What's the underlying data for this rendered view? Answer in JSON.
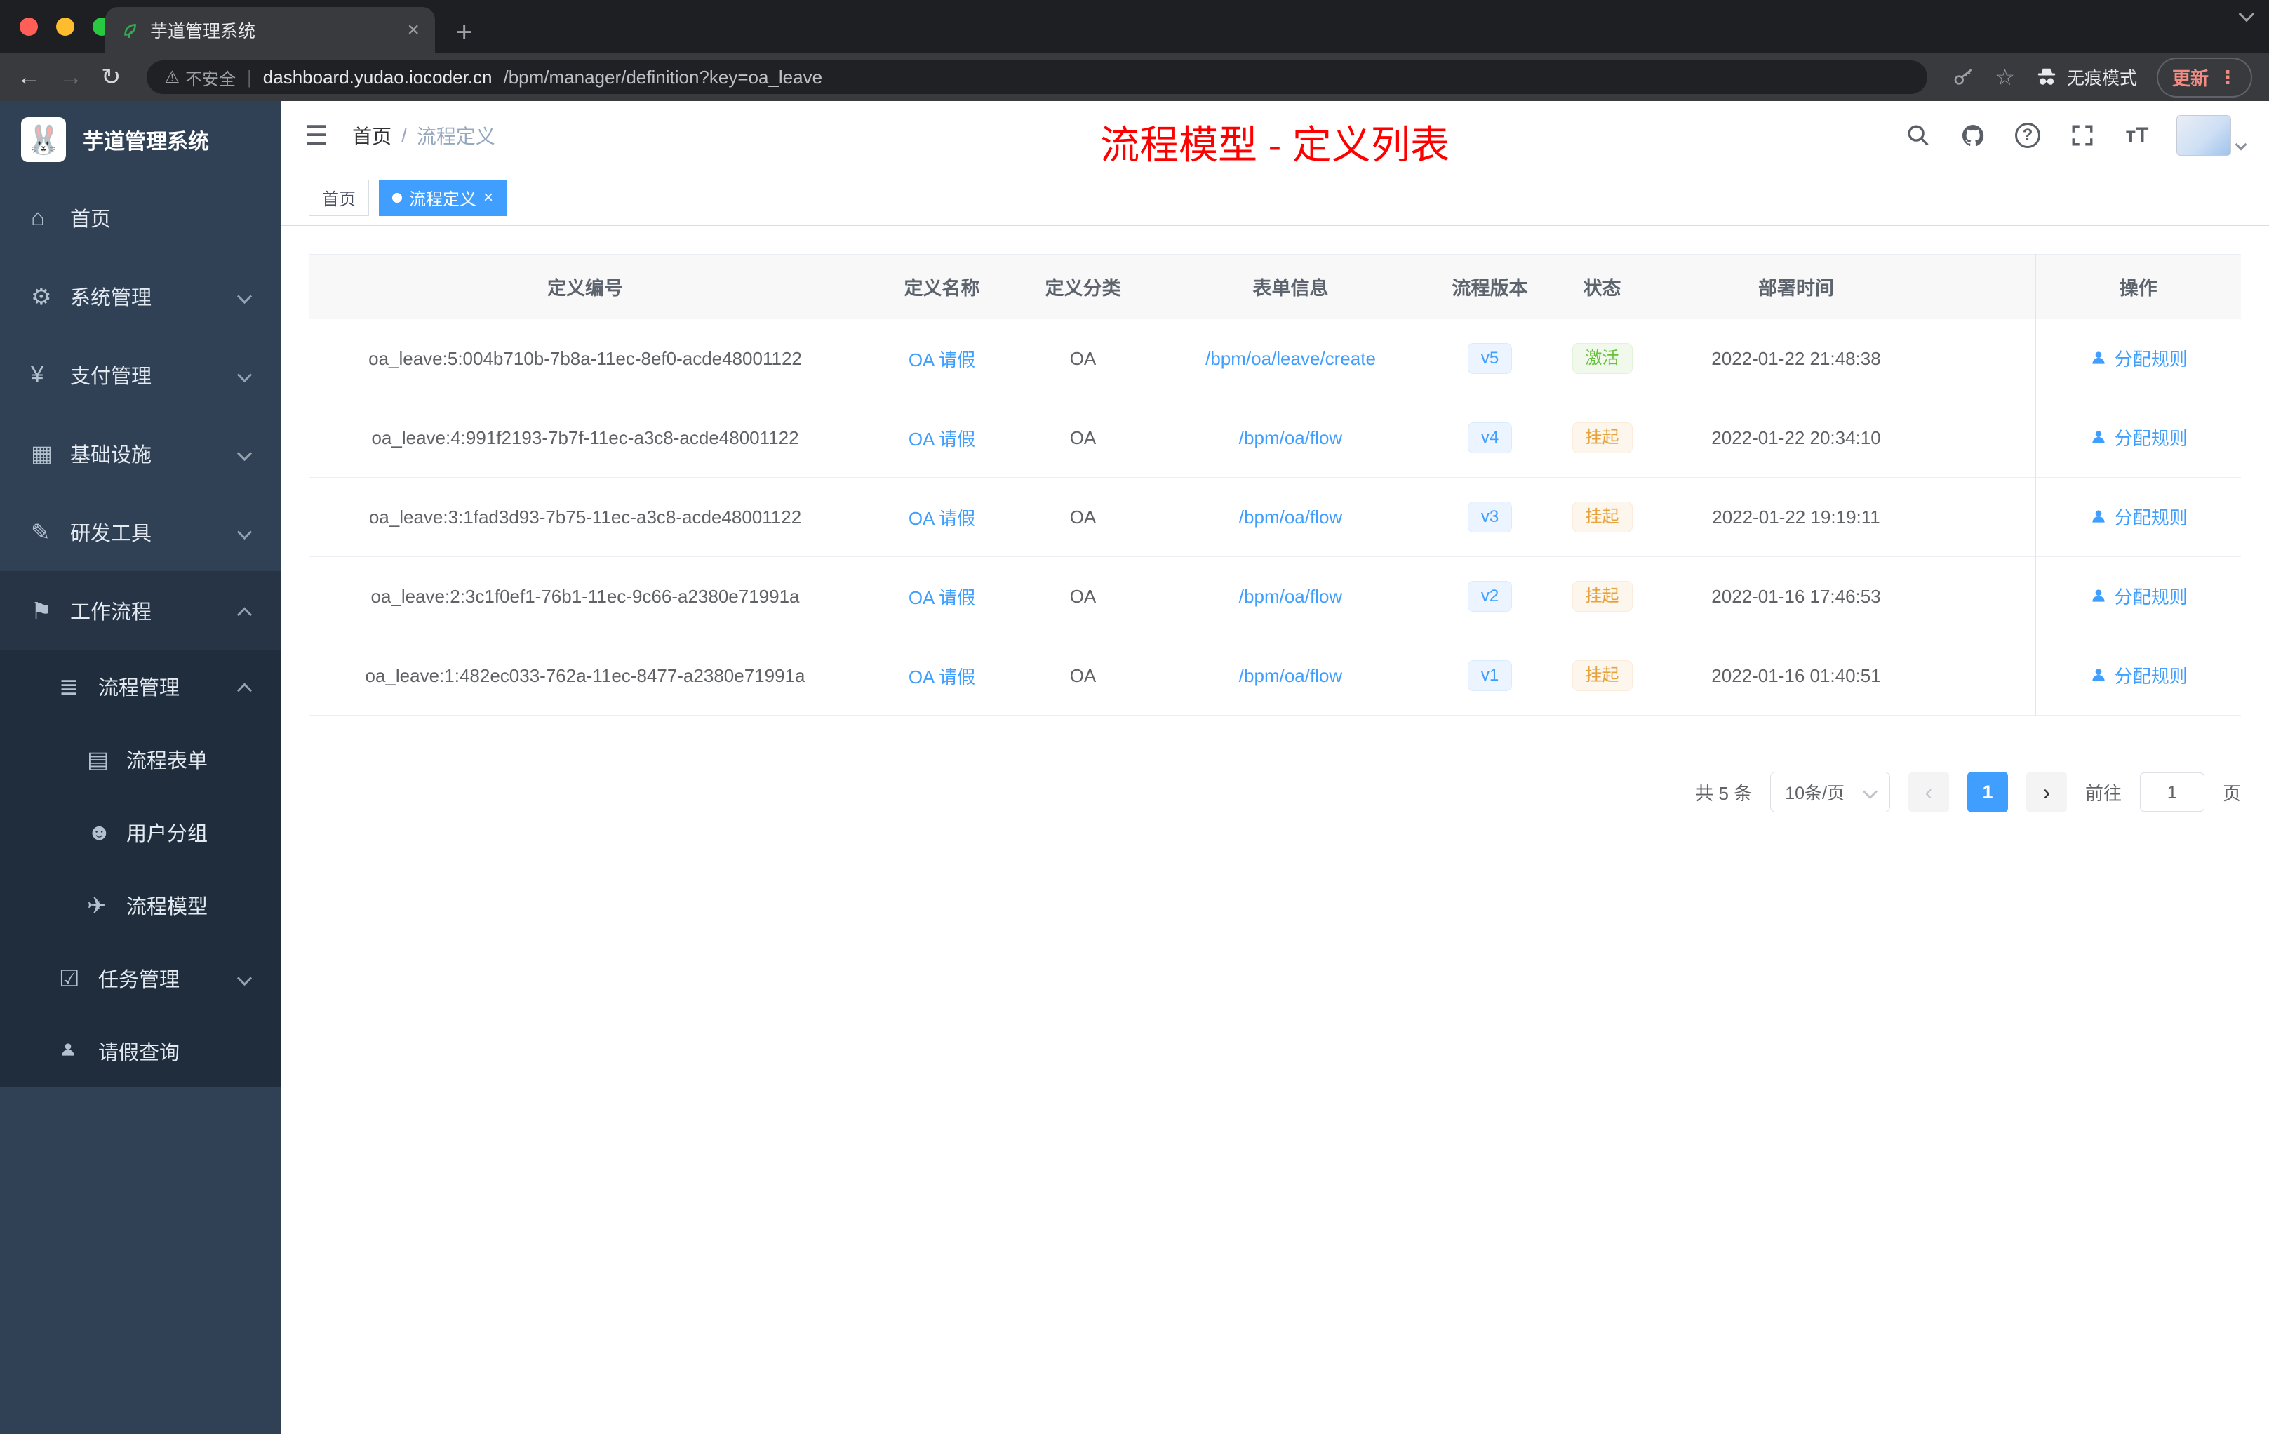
{
  "browser": {
    "tab": {
      "title": "芋道管理系统"
    },
    "address": {
      "security": "不安全",
      "url_host": "dashboard.yudao.iocoder.cn",
      "url_path": "/bpm/manager/definition?key=oa_leave",
      "incognito": "无痕模式",
      "update": "更新"
    }
  },
  "sidebar": {
    "logo_title": "芋道管理系统",
    "items": {
      "home": "首页",
      "system": "系统管理",
      "payment": "支付管理",
      "infra": "基础设施",
      "devtools": "研发工具",
      "workflow": "工作流程",
      "process_mgmt": "流程管理",
      "process_form": "流程表单",
      "user_group": "用户分组",
      "process_model": "流程模型",
      "task_mgmt": "任务管理",
      "leave_query": "请假查询"
    }
  },
  "header": {
    "breadcrumb_home": "首页",
    "breadcrumb_sep": "/",
    "breadcrumb_current": "流程定义",
    "annotation": "流程模型 - 定义列表"
  },
  "tags": {
    "home": "首页",
    "active": "流程定义"
  },
  "table": {
    "columns": {
      "id": "定义编号",
      "name": "定义名称",
      "category": "定义分类",
      "form": "表单信息",
      "version": "流程版本",
      "status": "状态",
      "deploy_time": "部署时间",
      "action": "操作"
    },
    "rows": [
      {
        "id": "oa_leave:5:004b710b-7b8a-11ec-8ef0-acde48001122",
        "name": "OA 请假",
        "category": "OA",
        "form": "/bpm/oa/leave/create",
        "version": "v5",
        "status": "激活",
        "status_type": "success",
        "deploy_time": "2022-01-22 21:48:38",
        "action": "分配规则"
      },
      {
        "id": "oa_leave:4:991f2193-7b7f-11ec-a3c8-acde48001122",
        "name": "OA 请假",
        "category": "OA",
        "form": "/bpm/oa/flow",
        "version": "v4",
        "status": "挂起",
        "status_type": "warning",
        "deploy_time": "2022-01-22 20:34:10",
        "action": "分配规则"
      },
      {
        "id": "oa_leave:3:1fad3d93-7b75-11ec-a3c8-acde48001122",
        "name": "OA 请假",
        "category": "OA",
        "form": "/bpm/oa/flow",
        "version": "v3",
        "status": "挂起",
        "status_type": "warning",
        "deploy_time": "2022-01-22 19:19:11",
        "action": "分配规则"
      },
      {
        "id": "oa_leave:2:3c1f0ef1-76b1-11ec-9c66-a2380e71991a",
        "name": "OA 请假",
        "category": "OA",
        "form": "/bpm/oa/flow",
        "version": "v2",
        "status": "挂起",
        "status_type": "warning",
        "deploy_time": "2022-01-16 17:46:53",
        "action": "分配规则"
      },
      {
        "id": "oa_leave:1:482ec033-762a-11ec-8477-a2380e71991a",
        "name": "OA 请假",
        "category": "OA",
        "form": "/bpm/oa/flow",
        "version": "v1",
        "status": "挂起",
        "status_type": "warning",
        "deploy_time": "2022-01-16 01:40:51",
        "action": "分配规则"
      }
    ]
  },
  "pagination": {
    "total": "共 5 条",
    "page_size": "10条/页",
    "page": "1",
    "goto_label": "前往",
    "goto_value": "1",
    "unit": "页"
  },
  "icons": {
    "home": "⌂",
    "system": "⚙",
    "payment": "¥",
    "infra": "▦",
    "devtools": "✎",
    "workflow": "⚑",
    "process_mgmt": "≣",
    "process_form": "▤",
    "user_group": "☻",
    "process_model": "✈",
    "task_mgmt": "☑",
    "back": "←",
    "forward": "→",
    "reload": "↻",
    "warning": "⚠",
    "star": "☆",
    "more": "⋮",
    "tab_close": "×",
    "new_tab": "+",
    "hamburger": "☰",
    "help": "?",
    "font_size": "тT",
    "dot": "●",
    "close": "×",
    "prev": "‹",
    "next": "›"
  },
  "colors": {
    "accent": "#409eff",
    "success": "#67c23a",
    "warning": "#e6a23c",
    "annotation": "#ff0000",
    "sidebar_bg": "#304156"
  }
}
